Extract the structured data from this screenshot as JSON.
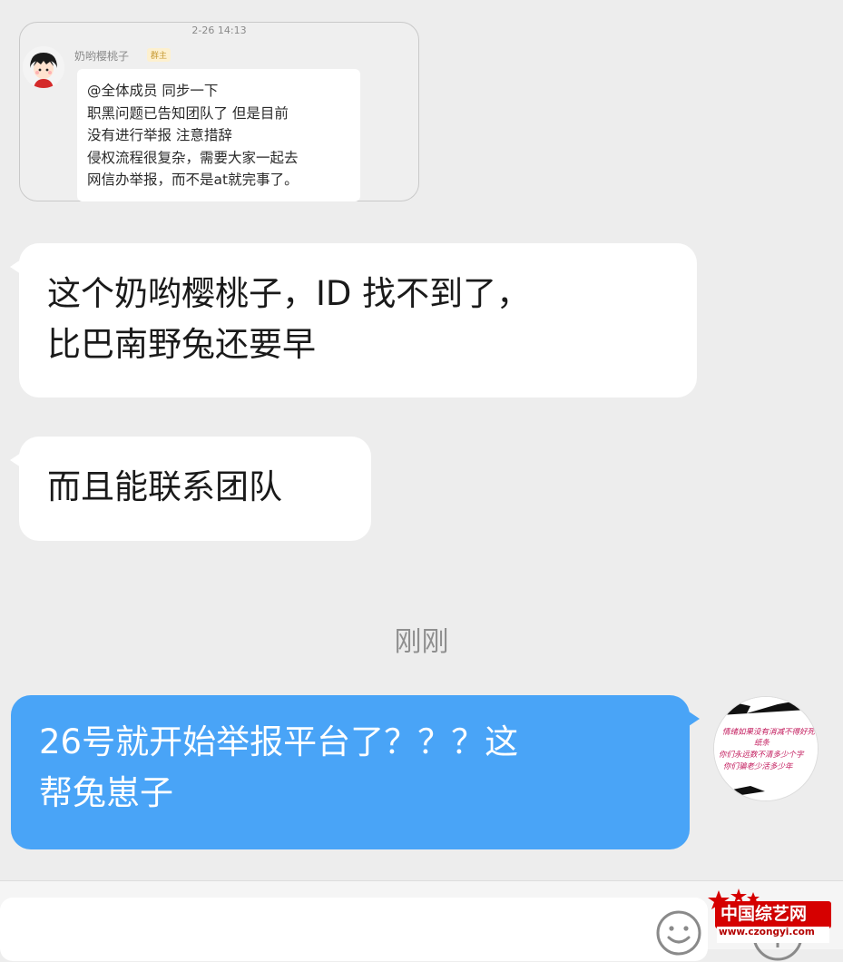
{
  "quoted_message": {
    "time": "2-26 14:13",
    "sender_name": "奶哟樱桃子",
    "sender_badge": "群主",
    "lines": [
      "@全体成员 同步一下",
      "职黑问题已告知团队了 但是目前",
      "没有进行举报 注意措辞",
      "侵权流程很复杂，需要大家一起去",
      "网信办举报，而不是at就完事了。"
    ]
  },
  "messages_in": [
    {
      "lines": [
        "这个奶哟樱桃子，ID 找不到了，",
        "比巴南野兔还要早"
      ]
    },
    {
      "lines": [
        "而且能联系团队"
      ]
    }
  ],
  "time_divider": "刚刚",
  "message_out": {
    "lines": [
      "26号就开始举报平台了？？？这",
      "帮兔崽子"
    ]
  },
  "self_avatar": {
    "lines": [
      "情绪如果没有消减不得好死",
      "纸条",
      "你们永远数不清多少个字",
      "你们骗老少活多少年"
    ],
    "accent": "#c2185b"
  },
  "input_bar": {
    "emoji_icon": "smiley-icon",
    "more_icon": "plus-circle-icon"
  },
  "watermark": {
    "text": "中国综艺网",
    "url": "www.czongyi.com",
    "color": "#d60000"
  },
  "colors": {
    "background": "#ededed",
    "bubble_out": "#49a4f7",
    "bubble_in": "#ffffff"
  }
}
